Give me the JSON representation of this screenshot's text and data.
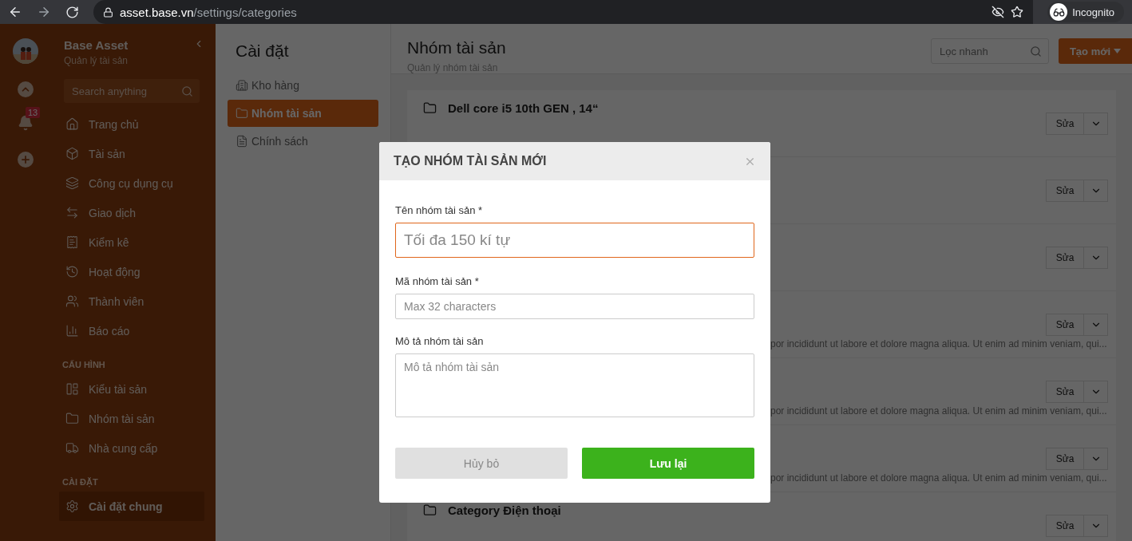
{
  "browser": {
    "host": "asset.base.vn",
    "path": "/settings/categories",
    "profile": "Incognito"
  },
  "sidebar": {
    "app_name": "Base Asset",
    "app_subtitle": "Quản lý tài sản",
    "search_placeholder": "Search anything",
    "notification_count": "13",
    "groups": [
      {
        "items": [
          {
            "label": "Trang chủ",
            "selected": false
          },
          {
            "label": "Tài sản",
            "selected": false
          },
          {
            "label": "Công cụ dụng cụ",
            "selected": false
          },
          {
            "label": "Giao dịch",
            "selected": false
          },
          {
            "label": "Kiểm kê",
            "selected": false
          },
          {
            "label": "Hoạt động",
            "selected": false
          },
          {
            "label": "Thành viên",
            "selected": false
          },
          {
            "label": "Báo cáo",
            "selected": false
          }
        ]
      },
      {
        "heading": "CẤU HÌNH",
        "items": [
          {
            "label": "Kiểu tài sản",
            "selected": false
          },
          {
            "label": "Nhóm tài sản",
            "selected": false
          },
          {
            "label": "Nhà cung cấp",
            "selected": false
          }
        ]
      },
      {
        "heading": "CÀI ĐẶT",
        "items": [
          {
            "label": "Cài đặt chung",
            "selected": true
          }
        ]
      }
    ]
  },
  "settings_menu": {
    "title": "Cài đặt",
    "items": [
      {
        "label": "Kho hàng",
        "selected": false
      },
      {
        "label": "Nhóm tài sản",
        "selected": true
      },
      {
        "label": "Chính sách",
        "selected": false
      }
    ]
  },
  "page": {
    "title": "Nhóm tài sản",
    "subtitle": "Quản lý nhóm tài sản",
    "search_placeholder": "Lọc nhanh",
    "create_button": "Tạo mới"
  },
  "categories": [
    {
      "title": "Dell core i5 10th GEN , 14“",
      "edit": "Sửa"
    },
    {
      "edit": "Sửa"
    },
    {
      "edit": "Sửa"
    },
    {
      "description": "por incididunt ut labore et dolore magna aliqua. Ut enim ad minim veniam, qui...",
      "edit": "Sửa"
    },
    {
      "description": "por incididunt ut labore et dolore magna aliqua. Ut enim ad minim veniam, qui...",
      "edit": "Sửa"
    },
    {
      "description": "por incididunt ut labore et dolore magna aliqua. Ut enim ad minim veniam, qui...",
      "edit": "Sửa"
    },
    {
      "title": "Category Điện thoại",
      "edit": "Sửa"
    }
  ],
  "modal": {
    "title": "TẠO NHÓM TÀI SẢN MỚI",
    "fields": [
      {
        "label": "Tên nhóm tài sản *",
        "placeholder": "Tối đa 150 kí tự",
        "kind": "input",
        "focused": true
      },
      {
        "label": "Mã nhóm tài sản *",
        "placeholder": "Max 32 characters",
        "kind": "input",
        "focused": false
      },
      {
        "label": "Mô tả nhóm tài sản",
        "placeholder": "Mô tả nhóm tài sản",
        "kind": "textarea",
        "focused": false
      }
    ],
    "cancel": "Hủy bỏ",
    "save": "Lưu lại"
  }
}
